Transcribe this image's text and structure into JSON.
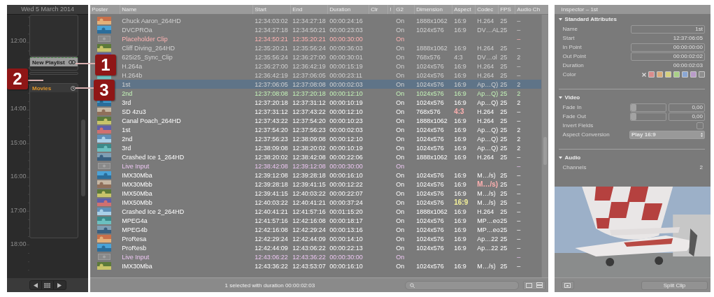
{
  "calendar": {
    "date": "Wed 5 March 2014",
    "hours": [
      {
        "label": "12:00"
      },
      {
        "label": "14:00"
      },
      {
        "label": "15:00"
      },
      {
        "label": "16:00"
      },
      {
        "label": "17:00"
      },
      {
        "label": "18:00"
      }
    ],
    "events": [
      {
        "kind": "linked",
        "title": "New Playlist",
        "selected": true
      },
      {
        "kind": "scheduled",
        "title": "Movies",
        "selected": false
      }
    ]
  },
  "callouts": [
    {
      "label": "1"
    },
    {
      "label": "2"
    },
    {
      "label": "3"
    }
  ],
  "table": {
    "columns": [
      "Poster",
      "Name",
      "Start",
      "End",
      "Duration",
      "Clr",
      "!",
      "G2",
      "Dimension",
      "Aspect",
      "Codec",
      "FPS",
      "Audio Ch"
    ],
    "rows": [
      {
        "kind": "played",
        "selected": false,
        "name": "Chuck Aaron_264HD",
        "start": "12:34:03:02",
        "end": "12:34:27:18",
        "duration": "00:00:24:16",
        "g2": "On",
        "dimension": "1888x1062",
        "aspect": "16:9",
        "codec": "H.264",
        "fps": "25",
        "audio": "–"
      },
      {
        "kind": "played",
        "selected": false,
        "name": "DVCPROa",
        "start": "12:34:27:18",
        "end": "12:34:50:21",
        "duration": "00:00:23:03",
        "g2": "On",
        "dimension": "1024x576",
        "aspect": "16:9",
        "codec": "DV…AL",
        "fps": "25",
        "audio": "–"
      },
      {
        "kind": "placeholder",
        "selected": false,
        "name": "Placeholder Clip",
        "start": "12:34:50:21",
        "end": "12:35:20:21",
        "duration": "00:00:30:00",
        "g2": "On",
        "audio": "–"
      },
      {
        "kind": "played",
        "selected": false,
        "name": "Cliff Diving_264HD",
        "start": "12:35:20:21",
        "end": "12:35:56:24",
        "duration": "00:00:36:03",
        "g2": "On",
        "dimension": "1888x1062",
        "aspect": "16:9",
        "codec": "H.264",
        "fps": "25",
        "audio": "–"
      },
      {
        "kind": "played",
        "selected": false,
        "name": "625i25_Sync_Clip",
        "start": "12:35:56:24",
        "end": "12:36:27:00",
        "duration": "00:00:30:01",
        "g2": "On",
        "dimension": "768x576",
        "aspect": "4:3",
        "codec": "DV…ol",
        "fps": "25",
        "audio": "2"
      },
      {
        "kind": "played",
        "selected": false,
        "name": "H.264a",
        "start": "12:36:27:00",
        "end": "12:36:42:19",
        "duration": "00:00:15:19",
        "g2": "On",
        "dimension": "1024x576",
        "aspect": "16:9",
        "codec": "H.264",
        "fps": "25",
        "audio": "–"
      },
      {
        "kind": "played",
        "selected": false,
        "name": "H.264b",
        "start": "12:36:42:19",
        "end": "12:37:06:05",
        "duration": "00:00:23:11",
        "g2": "On",
        "dimension": "1024x576",
        "aspect": "16:9",
        "codec": "H.264",
        "fps": "25",
        "audio": "–"
      },
      {
        "kind": "played",
        "selected": true,
        "name": "1st",
        "start": "12:37:06:05",
        "end": "12:37:08:08",
        "duration": "00:00:02:03",
        "g2": "On",
        "dimension": "1024x576",
        "aspect": "16:9",
        "codec": "Ap…Q)",
        "fps": "25",
        "audio": "2"
      },
      {
        "kind": "playing",
        "selected": false,
        "name": "2nd",
        "start": "12:37:08:08",
        "end": "12:37:20:18",
        "duration": "00:00:12:10",
        "g2": "On",
        "dimension": "1024x576",
        "aspect": "16:9",
        "codec": "Ap…Q)",
        "fps": "25",
        "audio": "2"
      },
      {
        "kind": "normal",
        "selected": false,
        "name": "3rd",
        "start": "12:37:20:18",
        "end": "12:37:31:12",
        "duration": "00:00:10:19",
        "g2": "On",
        "dimension": "1024x576",
        "aspect": "16:9",
        "codec": "Ap…Q)",
        "fps": "25",
        "audio": "2"
      },
      {
        "kind": "normal",
        "selected": false,
        "name": "SD 4zu3",
        "start": "12:37:31:12",
        "end": "12:37:43:22",
        "duration": "00:00:12:10",
        "g2": "On",
        "dimension": "768x576",
        "aspect": {
          "text": "4:3",
          "color": "#ffb0b0"
        },
        "codec": "H.264",
        "fps": "25",
        "audio": "–"
      },
      {
        "kind": "normal",
        "selected": false,
        "name": "Canal Poach_264HD",
        "start": "12:37:43:22",
        "end": "12:37:54:20",
        "duration": "00:00:10:23",
        "g2": "On",
        "dimension": "1888x1062",
        "aspect": "16:9",
        "codec": "H.264",
        "fps": "25",
        "audio": "–"
      },
      {
        "kind": "normal",
        "selected": false,
        "name": "1st",
        "start": "12:37:54:20",
        "end": "12:37:56:23",
        "duration": "00:00:02:03",
        "g2": "On",
        "dimension": "1024x576",
        "aspect": "16:9",
        "codec": "Ap…Q)",
        "fps": "25",
        "audio": "2"
      },
      {
        "kind": "normal",
        "selected": false,
        "name": "2nd",
        "start": "12:37:56:23",
        "end": "12:38:09:08",
        "duration": "00:00:12:10",
        "g2": "On",
        "dimension": "1024x576",
        "aspect": "16:9",
        "codec": "Ap…Q)",
        "fps": "25",
        "audio": "2"
      },
      {
        "kind": "normal",
        "selected": false,
        "name": "3rd",
        "start": "12:38:09:08",
        "end": "12:38:20:02",
        "duration": "00:00:10:19",
        "g2": "On",
        "dimension": "1024x576",
        "aspect": "16:9",
        "codec": "Ap…Q)",
        "fps": "25",
        "audio": "2"
      },
      {
        "kind": "normal",
        "selected": false,
        "name": "Crashed Ice 1_264HD",
        "start": "12:38:20:02",
        "end": "12:38:42:08",
        "duration": "00:00:22:06",
        "g2": "On",
        "dimension": "1888x1062",
        "aspect": "16:9",
        "codec": "H.264",
        "fps": "25",
        "audio": "–"
      },
      {
        "kind": "live",
        "selected": false,
        "name": "Live Input",
        "start": "12:38:42:08",
        "end": "12:39:12:08",
        "duration": "00:00:30:00",
        "g2": "On",
        "audio": "–"
      },
      {
        "kind": "normal",
        "selected": false,
        "name": "IMX30Mba",
        "start": "12:39:12:08",
        "end": "12:39:28:18",
        "duration": "00:00:16:10",
        "g2": "On",
        "dimension": "1024x576",
        "aspect": "16:9",
        "codec": "M…/s)",
        "fps": "25",
        "audio": "–"
      },
      {
        "kind": "normal",
        "selected": false,
        "name": "IMX30Mbb",
        "start": "12:39:28:18",
        "end": "12:39:41:15",
        "duration": "00:00:12:22",
        "g2": "On",
        "dimension": "1024x576",
        "aspect": "16:9",
        "codec": {
          "text": "M…/s)",
          "color": "#ffb0b0"
        },
        "fps": "25",
        "audio": "–"
      },
      {
        "kind": "normal",
        "selected": false,
        "name": "IMX50Mba",
        "start": "12:39:41:15",
        "end": "12:40:03:22",
        "duration": "00:00:22:07",
        "g2": "On",
        "dimension": "1024x576",
        "aspect": "16:9",
        "codec": "M…/s)",
        "fps": "25",
        "audio": "–"
      },
      {
        "kind": "normal",
        "selected": false,
        "name": "IMX50Mbb",
        "start": "12:40:03:22",
        "end": "12:40:41:21",
        "duration": "00:00:37:24",
        "g2": "On",
        "dimension": "1024x576",
        "aspect": {
          "text": "16:9",
          "color": "#f5f29a"
        },
        "codec": "M…/s)",
        "fps": "25",
        "audio": "–"
      },
      {
        "kind": "normal",
        "selected": false,
        "name": "Crashed Ice 2_264HD",
        "start": "12:40:41:21",
        "end": "12:41:57:16",
        "duration": "00:01:15:20",
        "g2": "On",
        "dimension": "1888x1062",
        "aspect": "16:9",
        "codec": "H.264",
        "fps": "25",
        "audio": "–"
      },
      {
        "kind": "normal",
        "selected": false,
        "name": "MPEG4a",
        "start": "12:41:57:16",
        "end": "12:42:16:08",
        "duration": "00:00:18:17",
        "g2": "On",
        "dimension": "1024x576",
        "aspect": "16:9",
        "codec": "MP…eo",
        "fps": "25",
        "audio": "–"
      },
      {
        "kind": "normal",
        "selected": false,
        "name": "MPEG4b",
        "start": "12:42:16:08",
        "end": "12:42:29:24",
        "duration": "00:00:13:16",
        "g2": "On",
        "dimension": "1024x576",
        "aspect": "16:9",
        "codec": "MP…eo",
        "fps": "25",
        "audio": "–"
      },
      {
        "kind": "normal",
        "selected": false,
        "name": "ProResa",
        "start": "12:42:29:24",
        "end": "12:42:44:09",
        "duration": "00:00:14:10",
        "g2": "On",
        "dimension": "1024x576",
        "aspect": "16:9",
        "codec": "Ap…22",
        "fps": "25",
        "audio": "–"
      },
      {
        "kind": "normal",
        "selected": false,
        "name": "ProResb",
        "start": "12:42:44:09",
        "end": "12:43:06:22",
        "duration": "00:00:22:13",
        "g2": "On",
        "dimension": "1024x576",
        "aspect": "16:9",
        "codec": "Ap…22",
        "fps": "25",
        "audio": "–"
      },
      {
        "kind": "live",
        "selected": false,
        "name": "Live Input",
        "start": "12:43:06:22",
        "end": "12:43:36:22",
        "duration": "00:00:30:00",
        "g2": "On",
        "audio": "–"
      },
      {
        "kind": "normal",
        "selected": false,
        "name": "IMX30Mba",
        "start": "12:43:36:22",
        "end": "12:43:53:07",
        "duration": "00:00:16:10",
        "g2": "On",
        "dimension": "1024x576",
        "aspect": "16:9",
        "codec": "M…/s)",
        "fps": "25",
        "audio": "–"
      }
    ],
    "status_text": "1 selected with duration 00:00:02:03"
  },
  "inspector": {
    "title": "Inspector – 1st",
    "sections": [
      {
        "title": "Standard Attributes",
        "expanded": true,
        "rows": [
          {
            "kind": "field",
            "label": "Name",
            "value": "1st"
          },
          {
            "kind": "text",
            "label": "Start",
            "value": "12:37:06:05"
          },
          {
            "kind": "field",
            "label": "In Point",
            "value": "00:00:00:00"
          },
          {
            "kind": "field",
            "label": "Out Point",
            "value": "00:00:02:02"
          },
          {
            "kind": "text",
            "label": "Duration",
            "value": "00:00:02:03"
          },
          {
            "kind": "colors",
            "label": "Color",
            "colors": [
              {
                "color": "#d98c8c"
              },
              {
                "color": "#d9ab7a"
              },
              {
                "color": "#d6d07e"
              },
              {
                "color": "#a9cf86"
              },
              {
                "color": "#8aa7d4"
              },
              {
                "color": "#b99bc9"
              },
              {
                "color": "#8e8e8e"
              }
            ]
          }
        ]
      },
      {
        "title": "Video",
        "expanded": true,
        "rows": [
          {
            "kind": "slider",
            "label": "Fade In",
            "level": 0,
            "value": "0,00"
          },
          {
            "kind": "slider",
            "label": "Fade Out",
            "level": 0,
            "value": "0,00"
          },
          {
            "kind": "checkbox",
            "label": "Invert Fields",
            "checked": false
          },
          {
            "kind": "select",
            "label": "Aspect Conversion",
            "value": "Play 16:9"
          }
        ]
      },
      {
        "title": "Audio",
        "expanded": true,
        "rows": [
          {
            "kind": "text",
            "label": "Channels",
            "value": "2"
          }
        ]
      }
    ]
  },
  "actions": {
    "split": "Split Clip"
  }
}
